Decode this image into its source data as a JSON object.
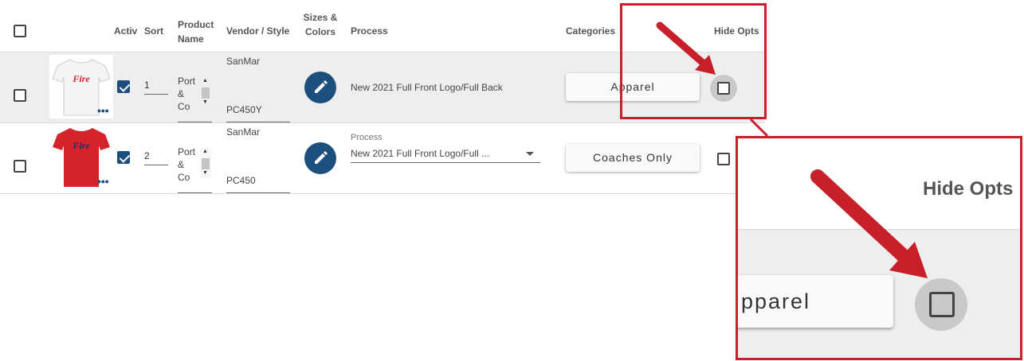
{
  "header": {
    "activ": "Activ",
    "sort": "Sort",
    "product_name": "Product Name",
    "vendor_style": "Vendor / Style",
    "sizes_colors": "Sizes & Colors",
    "process": "Process",
    "categories": "Categories",
    "hide_opts": "Hide Opts"
  },
  "rows": [
    {
      "checked": false,
      "active": true,
      "sort": "1",
      "product_name_lines": [
        "Port",
        "&",
        "Co"
      ],
      "vendor": "SanMar",
      "style": "PC450Y",
      "process_label": "",
      "process": "New 2021 Full Front Logo/Full Back",
      "category": "Apparel",
      "hide_opts": false,
      "shirt_color": "#f4f4f4",
      "logo_color": "#d4232a"
    },
    {
      "checked": false,
      "active": true,
      "sort": "2",
      "product_name_lines": [
        "Port",
        "&",
        "Co"
      ],
      "vendor": "SanMar",
      "style": "PC450",
      "process_label": "Process",
      "process": "New 2021 Full Front Logo/Full ...",
      "category": "Coaches Only",
      "hide_opts": false,
      "shirt_color": "#d4232a",
      "logo_color": "#1b2f6b"
    }
  ],
  "zoom": {
    "hide_opts": "Hide Opts",
    "category_fragment": "pparel"
  },
  "colors": {
    "accent": "#1d4f7e",
    "callout_red": "#c8202a"
  }
}
